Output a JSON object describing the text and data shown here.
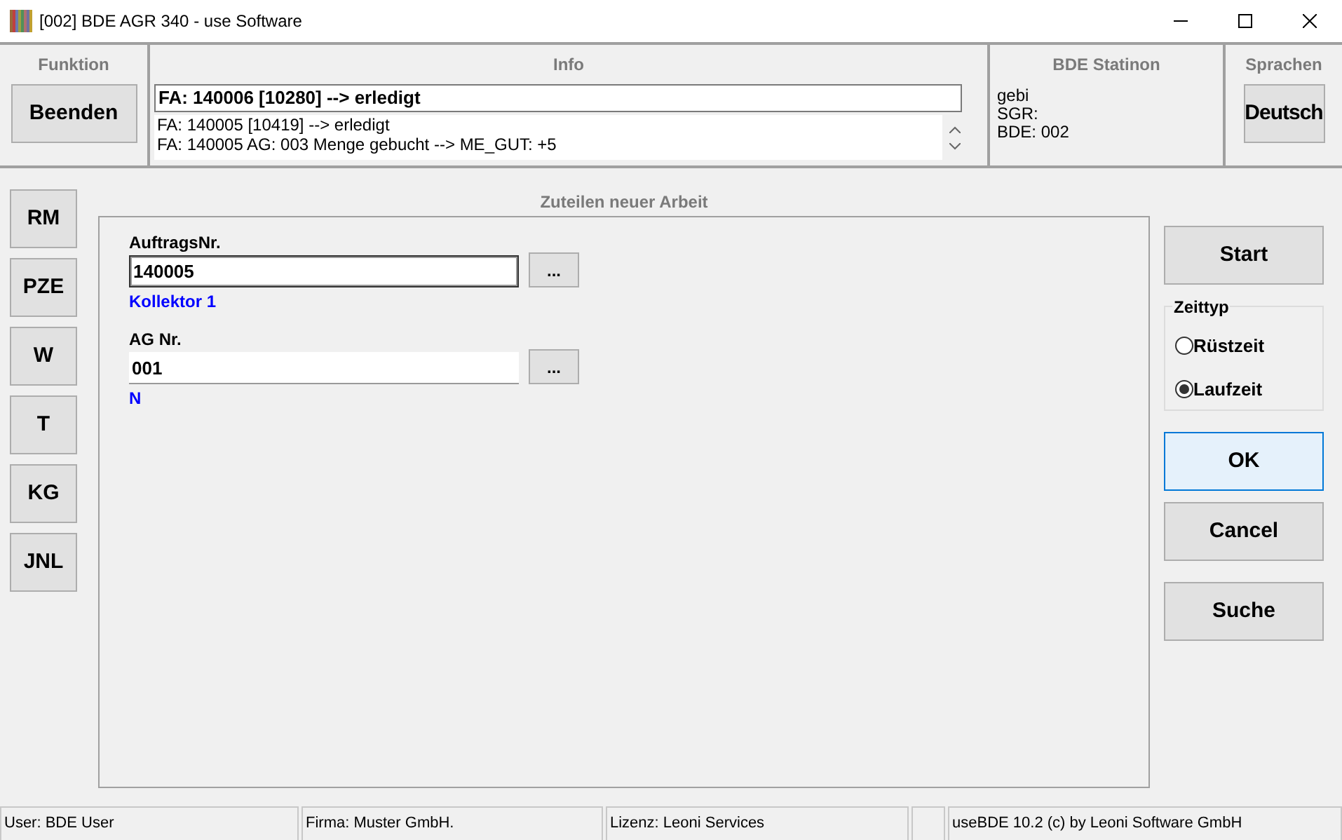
{
  "window": {
    "title": "[002] BDE AGR 340 - use Software"
  },
  "panels": {
    "funktion": {
      "heading": "Funktion",
      "button": "Beenden"
    },
    "info": {
      "heading": "Info",
      "current": "FA: 140006 [10280] --> erledigt",
      "messages": [
        "FA: 140005 [10419] --> erledigt",
        "FA: 140005 AG: 003 Menge gebucht --> ME_GUT: +5"
      ]
    },
    "station": {
      "heading": "BDE Statinon",
      "lines": [
        "gebi",
        "SGR:",
        "BDE: 002"
      ]
    },
    "sprachen": {
      "heading": "Sprachen",
      "button": "Deutsch"
    }
  },
  "side_buttons": [
    "RM",
    "PZE",
    "W",
    "T",
    "KG",
    "JNL"
  ],
  "form": {
    "title": "Zuteilen neuer Arbeit",
    "fields": [
      {
        "label": "AuftragsNr.",
        "value": "140005",
        "button": "...",
        "hint": "Kollektor 1",
        "focused": true
      },
      {
        "label": "AG Nr.",
        "value": "001",
        "button": "...",
        "hint": "N",
        "focused": false
      }
    ]
  },
  "actions": {
    "start": "Start",
    "zeittyp": {
      "title": "Zeittyp",
      "options": [
        {
          "label": "Rüstzeit",
          "selected": false
        },
        {
          "label": "Laufzeit",
          "selected": true
        }
      ]
    },
    "buttons": [
      {
        "label": "OK",
        "default": true
      },
      {
        "label": "Cancel",
        "default": false
      },
      {
        "label": "Suche",
        "default": false
      }
    ]
  },
  "status_bar": [
    "User: BDE User",
    "Firma: Muster GmbH.",
    "Lizenz: Leoni Services",
    "useBDE 10.2 (c) by Leoni Software GmbH"
  ]
}
